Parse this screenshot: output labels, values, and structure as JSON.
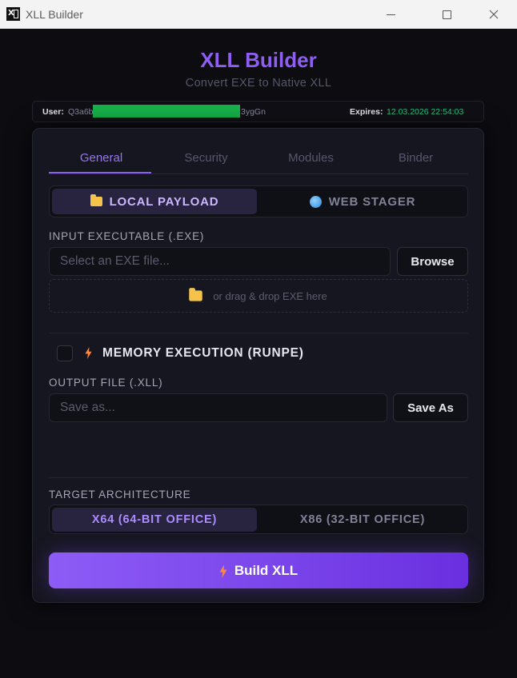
{
  "window": {
    "title": "XLL Builder",
    "app_icon": "excel-icon"
  },
  "header": {
    "title": "XLL Builder",
    "subtitle": "Convert EXE to Native XLL"
  },
  "license": {
    "user_label": "User:",
    "user_value_prefix": "Q3a6b",
    "user_value_suffix": "3ygGn",
    "user_redacted": true,
    "expires_label": "Expires:",
    "expires_value": "12.03.2026 22:54:03"
  },
  "tabs": [
    {
      "label": "General",
      "active": true
    },
    {
      "label": "Security",
      "active": false
    },
    {
      "label": "Modules",
      "active": false
    },
    {
      "label": "Binder",
      "active": false
    }
  ],
  "payload_mode": {
    "options": [
      {
        "label": "LOCAL PAYLOAD",
        "icon": "folder-icon",
        "active": true
      },
      {
        "label": "WEB STAGER",
        "icon": "globe-icon",
        "active": false
      }
    ]
  },
  "input": {
    "label": "INPUT EXECUTABLE (.EXE)",
    "placeholder": "Select an EXE file...",
    "browse_label": "Browse",
    "dropzone_text": "or drag & drop EXE here"
  },
  "memory_execution": {
    "label": "MEMORY EXECUTION (RUNPE)",
    "checked": false
  },
  "output": {
    "label": "OUTPUT FILE (.XLL)",
    "placeholder": "Save as...",
    "save_label": "Save As"
  },
  "architecture": {
    "label": "TARGET ARCHITECTURE",
    "options": [
      {
        "label": "X64 (64-BIT OFFICE)",
        "active": true
      },
      {
        "label": "X86 (32-BIT OFFICE)",
        "active": false
      }
    ]
  },
  "build": {
    "label": "Build XLL",
    "icon": "bolt-icon"
  },
  "colors": {
    "accent": "#8f5df2",
    "background": "#0c0c11",
    "card": "#161620",
    "expires": "#24c582",
    "bolt": "#ff8a3d"
  }
}
